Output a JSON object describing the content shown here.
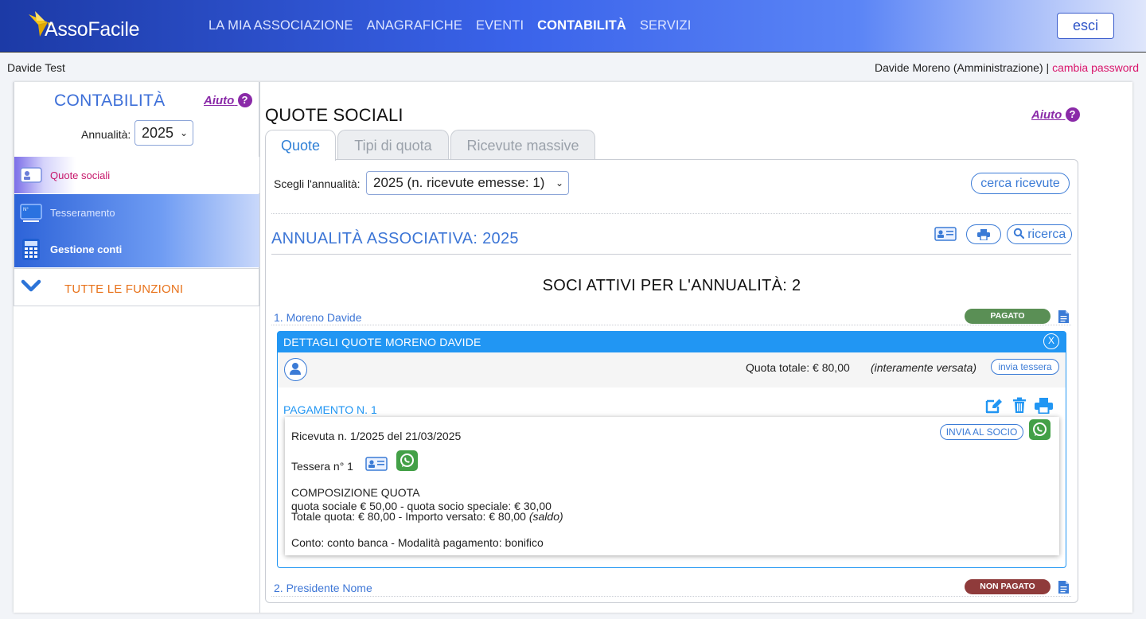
{
  "header": {
    "logo_text": "AssoFacile",
    "nav": [
      "LA MIA ASSOCIAZIONE",
      "ANAGRAFICHE",
      "EVENTI",
      "CONTABILITÀ",
      "SERVIZI"
    ],
    "active_nav": "CONTABILITÀ",
    "logout_label": "esci"
  },
  "userbar": {
    "left_name": "Davide Test",
    "right_user": "Davide Moreno (Amministrazione)",
    "separator": "|",
    "change_password": "cambia password"
  },
  "sidebar": {
    "title": "CONTABILITÀ",
    "help_label": "Aiuto",
    "year_label": "Annualità:",
    "year_value": "2025",
    "items": [
      {
        "label": "Quote sociali",
        "icon": "member-card-icon",
        "active": true
      },
      {
        "label": "Tesseramento",
        "icon": "membership-card-icon",
        "active": false
      },
      {
        "label": "Gestione conti",
        "icon": "calculator-icon",
        "active": false
      }
    ],
    "all_functions_label": "TUTTE LE FUNZIONI"
  },
  "main": {
    "title": "QUOTE SOCIALI",
    "help_label": "Aiuto",
    "tabs": [
      {
        "label": "Quote",
        "active": true
      },
      {
        "label": "Tipi di quota",
        "active": false
      },
      {
        "label": "Ricevute massive",
        "active": false
      }
    ],
    "year_select_label": "Scegli l'annualità:",
    "year_select_value": "2025 (n. ricevute emesse: 1)",
    "search_receipts_label": "cerca ricevute",
    "annual_title": "ANNUALITÀ ASSOCIATIVA: 2025",
    "search_label": "ricerca",
    "soci_title": "SOCI ATTIVI PER L'ANNUALITÀ: 2",
    "members": [
      {
        "name": "1. Moreno Davide",
        "status": "PAGATO"
      },
      {
        "name": "2. Presidente Nome",
        "status": "NON PAGATO"
      }
    ],
    "details": {
      "title": "DETTAGLI QUOTE MORENO DAVIDE",
      "close_label": "X",
      "total_label": "Quota totale: € 80,00",
      "total_note": "(interamente versata)",
      "send_card_label": "invia tessera",
      "payment_title": "PAGAMENTO N. 1",
      "receipt_line": "Ricevuta n. 1/2025 del 21/03/2025",
      "send_to_member_label": "INVIA AL SOCIO",
      "card_line": "Tessera n° 1",
      "composition_title": "COMPOSIZIONE QUOTA",
      "composition_line1": "quota sociale € 50,00 - quota socio speciale: € 30,00",
      "composition_line2": "Totale quota: € 80,00 - Importo versato: € 80,00",
      "composition_line2_note": "(saldo)",
      "account_line": "Conto: conto banca - Modalità pagamento: bonifico"
    }
  },
  "colors": {
    "accent": "#3d76d6",
    "paid": "#5a8f55",
    "unpaid": "#8f3b3b",
    "details_header": "#2196f3",
    "whatsapp": "#43a047"
  }
}
